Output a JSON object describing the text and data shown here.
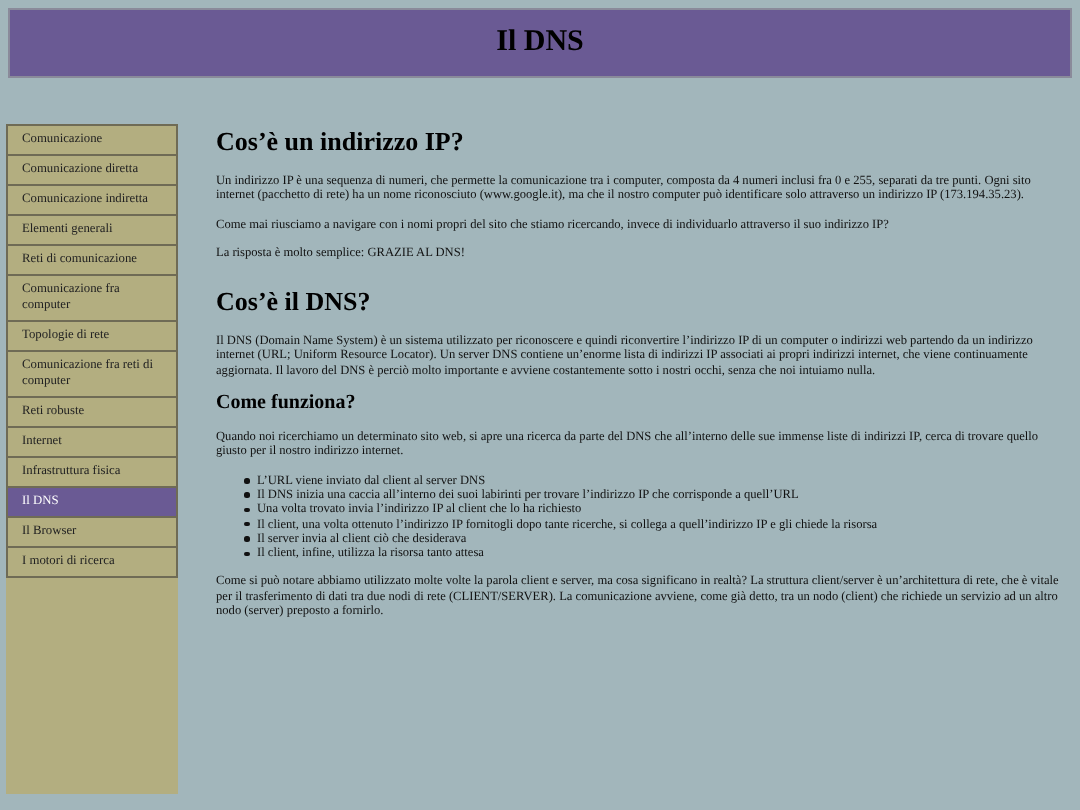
{
  "header": {
    "title": "Il DNS"
  },
  "sidebar": {
    "items": [
      {
        "label": "Comunicazione",
        "selected": false
      },
      {
        "label": "Comunicazione diretta",
        "selected": false
      },
      {
        "label": "Comunicazione indiretta",
        "selected": false
      },
      {
        "label": "Elementi generali",
        "selected": false
      },
      {
        "label": "Reti di comunicazione",
        "selected": false
      },
      {
        "label": "Comunicazione fra computer",
        "selected": false
      },
      {
        "label": "Topologie di rete",
        "selected": false
      },
      {
        "label": "Comunicazione fra reti di computer",
        "selected": false
      },
      {
        "label": "Reti robuste",
        "selected": false
      },
      {
        "label": "Internet",
        "selected": false
      },
      {
        "label": "Infrastruttura fisica",
        "selected": false
      },
      {
        "label": "Il DNS",
        "selected": true
      },
      {
        "label": "Il Browser",
        "selected": false
      },
      {
        "label": "I motori di ricerca",
        "selected": false
      }
    ]
  },
  "content": [
    {
      "kind": "h1",
      "text": "Cos’è un indirizzo IP?"
    },
    {
      "kind": "p",
      "text": "Un indirizzo IP è una sequenza di numeri, che permette la comunicazione tra i computer, composta da 4 numeri inclusi fra 0 e 255, separati da tre punti. Ogni sito internet (pacchetto di rete) ha un nome riconosciuto (www.google.it), ma che il nostro computer può identificare solo attraverso un indirizzo IP (173.194.35.23)."
    },
    {
      "kind": "p",
      "text": "Come mai riusciamo a navigare con i nomi propri del sito che stiamo ricercando, invece di individuarlo attraverso il suo indirizzo IP?"
    },
    {
      "kind": "p",
      "text": "La risposta è molto semplice: GRAZIE AL DNS!"
    },
    {
      "kind": "h1",
      "text": "Cos’è il DNS?"
    },
    {
      "kind": "p",
      "text": "Il DNS (Domain Name System) è un sistema utilizzato per riconoscere e quindi riconvertire l’indirizzo IP di un computer o indirizzi web partendo da un indirizzo internet (URL; Uniform Resource Locator). Un server DNS contiene un’enorme lista di indirizzi IP associati ai propri indirizzi internet, che viene continuamente aggiornata. Il lavoro del DNS è perciò molto importante e avviene costantemente sotto i nostri occhi, senza che noi intuiamo nulla."
    },
    {
      "kind": "h2",
      "text": "Come funziona?"
    },
    {
      "kind": "p",
      "text": "Quando noi ricerchiamo un determinato sito web, si apre una ricerca da parte del DNS che all’interno delle sue immense liste di indirizzi IP, cerca di trovare quello giusto per il nostro indirizzo internet."
    },
    {
      "kind": "list",
      "items": [
        "L’URL viene inviato dal client al server DNS",
        "Il DNS inizia una caccia all’interno dei suoi labirinti per trovare l’indirizzo IP che corrisponde a quell’URL",
        "Una volta trovato invia l’indirizzo IP al client che lo ha richiesto",
        "Il client, una volta ottenuto l’indirizzo IP fornitogli dopo tante ricerche, si collega a quell’indirizzo IP e gli chiede la risorsa",
        "Il server invia al client ciò che desiderava",
        "Il client, infine, utilizza la risorsa tanto attesa"
      ]
    },
    {
      "kind": "p",
      "text": "Come si può notare abbiamo utilizzato molte volte la parola client e server, ma cosa significano in realtà? La struttura client/server è un’architettura di rete, che è vitale per il trasferimento di dati tra due nodi di rete (CLIENT/SERVER). La comunicazione avviene, come già detto, tra un nodo (client) che richiede un servizio ad un altro nodo (server) preposto a fornirlo."
    }
  ]
}
